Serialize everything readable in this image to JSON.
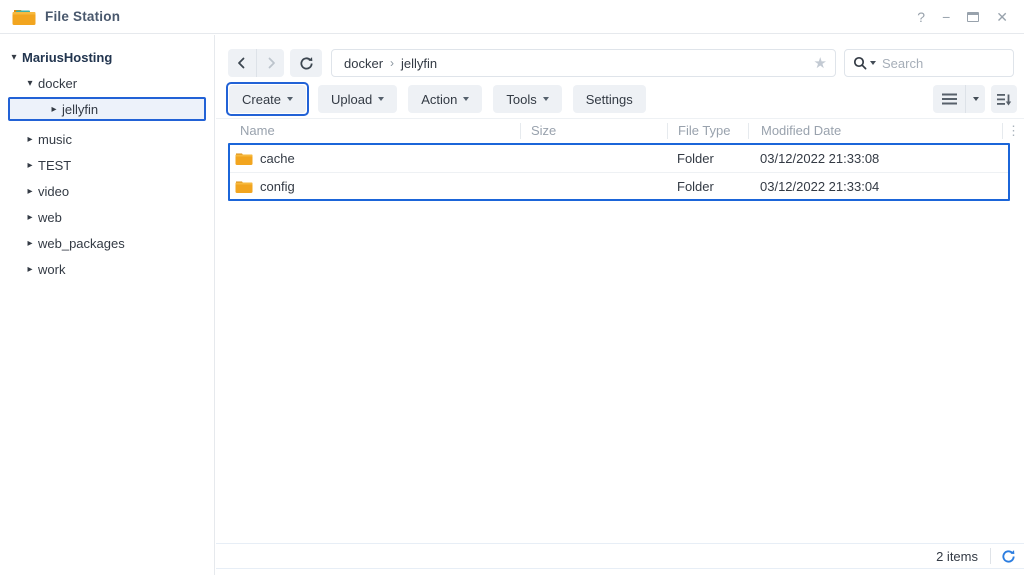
{
  "app": {
    "title": "File Station"
  },
  "window": {
    "help": "?",
    "minimize": "−",
    "close": "✕"
  },
  "sidebar": {
    "items": [
      {
        "label": "MariusHosting",
        "state": "expanded"
      },
      {
        "label": "docker",
        "state": "expanded"
      },
      {
        "label": "jellyfin",
        "state": "collapsed",
        "selected": true
      },
      {
        "label": "music",
        "state": "collapsed"
      },
      {
        "label": "TEST",
        "state": "collapsed"
      },
      {
        "label": "video",
        "state": "collapsed"
      },
      {
        "label": "web",
        "state": "collapsed"
      },
      {
        "label": "web_packages",
        "state": "collapsed"
      },
      {
        "label": "work",
        "state": "collapsed"
      }
    ],
    "caret_expanded": "▾",
    "caret_collapsed": "▸"
  },
  "nav": {
    "breadcrumb": {
      "parent": "docker",
      "separator": "›",
      "current": "jellyfin"
    },
    "search": {
      "placeholder": "Search"
    }
  },
  "toolbar": {
    "create": "Create",
    "upload": "Upload",
    "action": "Action",
    "tools": "Tools",
    "settings": "Settings"
  },
  "table": {
    "columns": {
      "name": "Name",
      "size": "Size",
      "type": "File Type",
      "modified": "Modified Date",
      "more": "⋮"
    },
    "rows": [
      {
        "name": "cache",
        "size": "",
        "type": "Folder",
        "modified": "03/12/2022 21:33:08"
      },
      {
        "name": "config",
        "size": "",
        "type": "Folder",
        "modified": "03/12/2022 21:33:04"
      }
    ]
  },
  "status": {
    "count": "2 items"
  },
  "colors": {
    "accent": "#1b65d9",
    "folder": "#f2a51f",
    "refresh_blue": "#2b7de0"
  }
}
